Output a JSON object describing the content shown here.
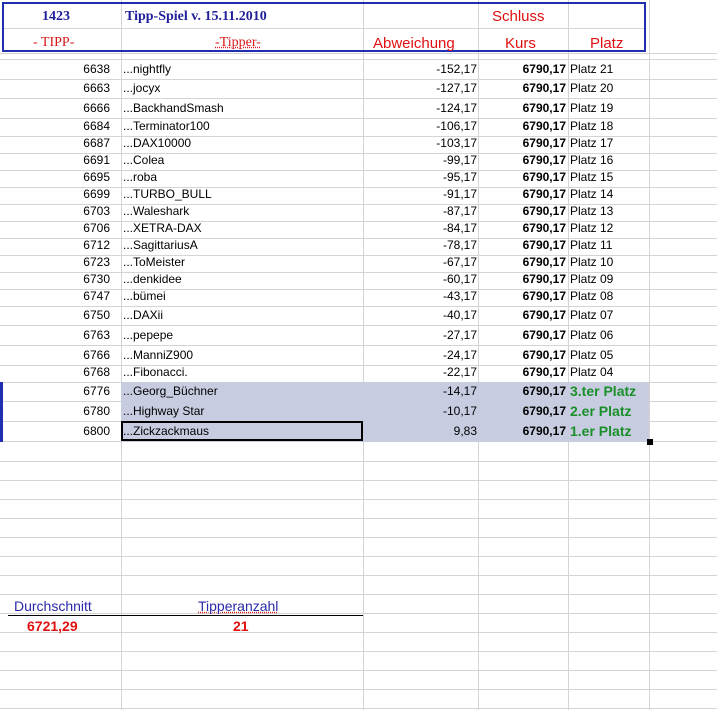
{
  "header": {
    "id": "1423",
    "title": "Tipp-Spiel v. 15.11.2010",
    "schluss": "Schluss",
    "col_tipp": "- TIPP-",
    "col_tipper": "-Tipper-",
    "col_abweichung": "Abweichung",
    "col_kurs": "Kurs",
    "col_platz": "Platz"
  },
  "rows": [
    {
      "tipp": "6638",
      "name": "...nightfly",
      "abw": "-152,17",
      "kurs": "6790,17",
      "platz": "Platz 21"
    },
    {
      "tipp": "6663",
      "name": "...jocyx",
      "abw": "-127,17",
      "kurs": "6790,17",
      "platz": "Platz 20"
    },
    {
      "tipp": "6666",
      "name": "...BackhandSmash",
      "abw": "-124,17",
      "kurs": "6790,17",
      "platz": "Platz 19"
    },
    {
      "tipp": "6684",
      "name": "...Terminator100",
      "abw": "-106,17",
      "kurs": "6790,17",
      "platz": "Platz 18"
    },
    {
      "tipp": "6687",
      "name": "...DAX10000",
      "abw": "-103,17",
      "kurs": "6790,17",
      "platz": "Platz 17"
    },
    {
      "tipp": "6691",
      "name": "...Colea",
      "abw": "-99,17",
      "kurs": "6790,17",
      "platz": "Platz 16"
    },
    {
      "tipp": "6695",
      "name": "...roba",
      "abw": "-95,17",
      "kurs": "6790,17",
      "platz": "Platz 15"
    },
    {
      "tipp": "6699",
      "name": "...TURBO_BULL",
      "abw": "-91,17",
      "kurs": "6790,17",
      "platz": "Platz 14"
    },
    {
      "tipp": "6703",
      "name": "...Waleshark",
      "abw": "-87,17",
      "kurs": "6790,17",
      "platz": "Platz 13"
    },
    {
      "tipp": "6706",
      "name": "...XETRA-DAX",
      "abw": "-84,17",
      "kurs": "6790,17",
      "platz": "Platz 12"
    },
    {
      "tipp": "6712",
      "name": "...SagittariusA",
      "abw": "-78,17",
      "kurs": "6790,17",
      "platz": "Platz 11"
    },
    {
      "tipp": "6723",
      "name": "...ToMeister",
      "abw": "-67,17",
      "kurs": "6790,17",
      "platz": "Platz 10"
    },
    {
      "tipp": "6730",
      "name": "...denkidee",
      "abw": "-60,17",
      "kurs": "6790,17",
      "platz": "Platz 09"
    },
    {
      "tipp": "6747",
      "name": "...bümei",
      "abw": "-43,17",
      "kurs": "6790,17",
      "platz": "Platz 08"
    },
    {
      "tipp": "6750",
      "name": "...DAXii",
      "abw": "-40,17",
      "kurs": "6790,17",
      "platz": "Platz 07"
    },
    {
      "tipp": "6763",
      "name": "...pepepe",
      "abw": "-27,17",
      "kurs": "6790,17",
      "platz": "Platz 06"
    },
    {
      "tipp": "6766",
      "name": "...ManniZ900",
      "abw": "-24,17",
      "kurs": "6790,17",
      "platz": "Platz 05"
    },
    {
      "tipp": "6768",
      "name": "...Fibonacci.",
      "abw": "-22,17",
      "kurs": "6790,17",
      "platz": "Platz 04"
    },
    {
      "tipp": "6776",
      "name": "...Georg_Büchner",
      "abw": "-14,17",
      "kurs": "6790,17",
      "platz": "3.ter Platz"
    },
    {
      "tipp": "6780",
      "name": "...Highway Star",
      "abw": "-10,17",
      "kurs": "6790,17",
      "platz": "2.er Platz"
    },
    {
      "tipp": "6800",
      "name": "...Zickzackmaus",
      "abw": "9,83",
      "kurs": "6790,17",
      "platz": "1.er Platz"
    }
  ],
  "footer": {
    "avg_label": "Durchschnitt",
    "avg_value": "6721,29",
    "count_label": "Tipperanzahl",
    "count_value": "21"
  },
  "colors": {
    "header_blue": "#1f2fb0",
    "header_red": "#e01010",
    "winner_green": "#1a8f2a",
    "highlight": "#c7cce0"
  }
}
